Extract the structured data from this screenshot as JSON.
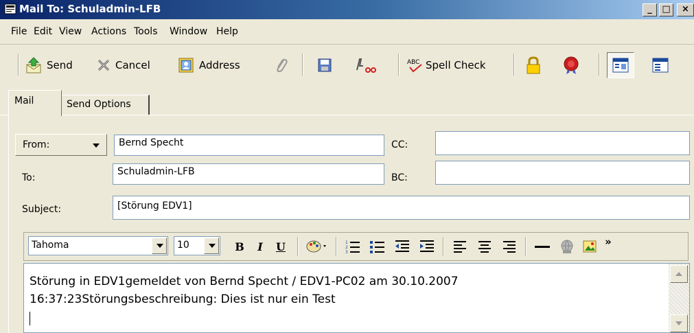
{
  "window": {
    "title": "Mail To: Schuladmin-LFB",
    "minimize": "_",
    "restore": "□",
    "close": "×"
  },
  "menu": [
    "File",
    "Edit",
    "View",
    "Actions",
    "Tools",
    "Window",
    "Help"
  ],
  "toolbar": {
    "send": "Send",
    "cancel": "Cancel",
    "address": "Address",
    "spell_check": "Spell Check"
  },
  "tabs": {
    "mail": "Mail",
    "send_options": "Send Options"
  },
  "form": {
    "from_label": "From:",
    "from_value": "Bernd Specht",
    "to_label": "To:",
    "to_value": "Schuladmin-LFB",
    "cc_label": "CC:",
    "cc_value": "",
    "bc_label": "BC:",
    "bc_value": "",
    "subject_label": "Subject:",
    "subject_value": "[Störung EDV1]"
  },
  "format": {
    "font": "Tahoma",
    "size": "10",
    "bold": "B",
    "italic": "I",
    "underline": "U",
    "more": "»"
  },
  "body": {
    "line1": "Störung in EDV1gemeldet von Bernd Specht / EDV1-PC02 am 30.10.2007",
    "line2": "16:37:23Störungsbeschreibung: Dies ist nur ein Test"
  }
}
